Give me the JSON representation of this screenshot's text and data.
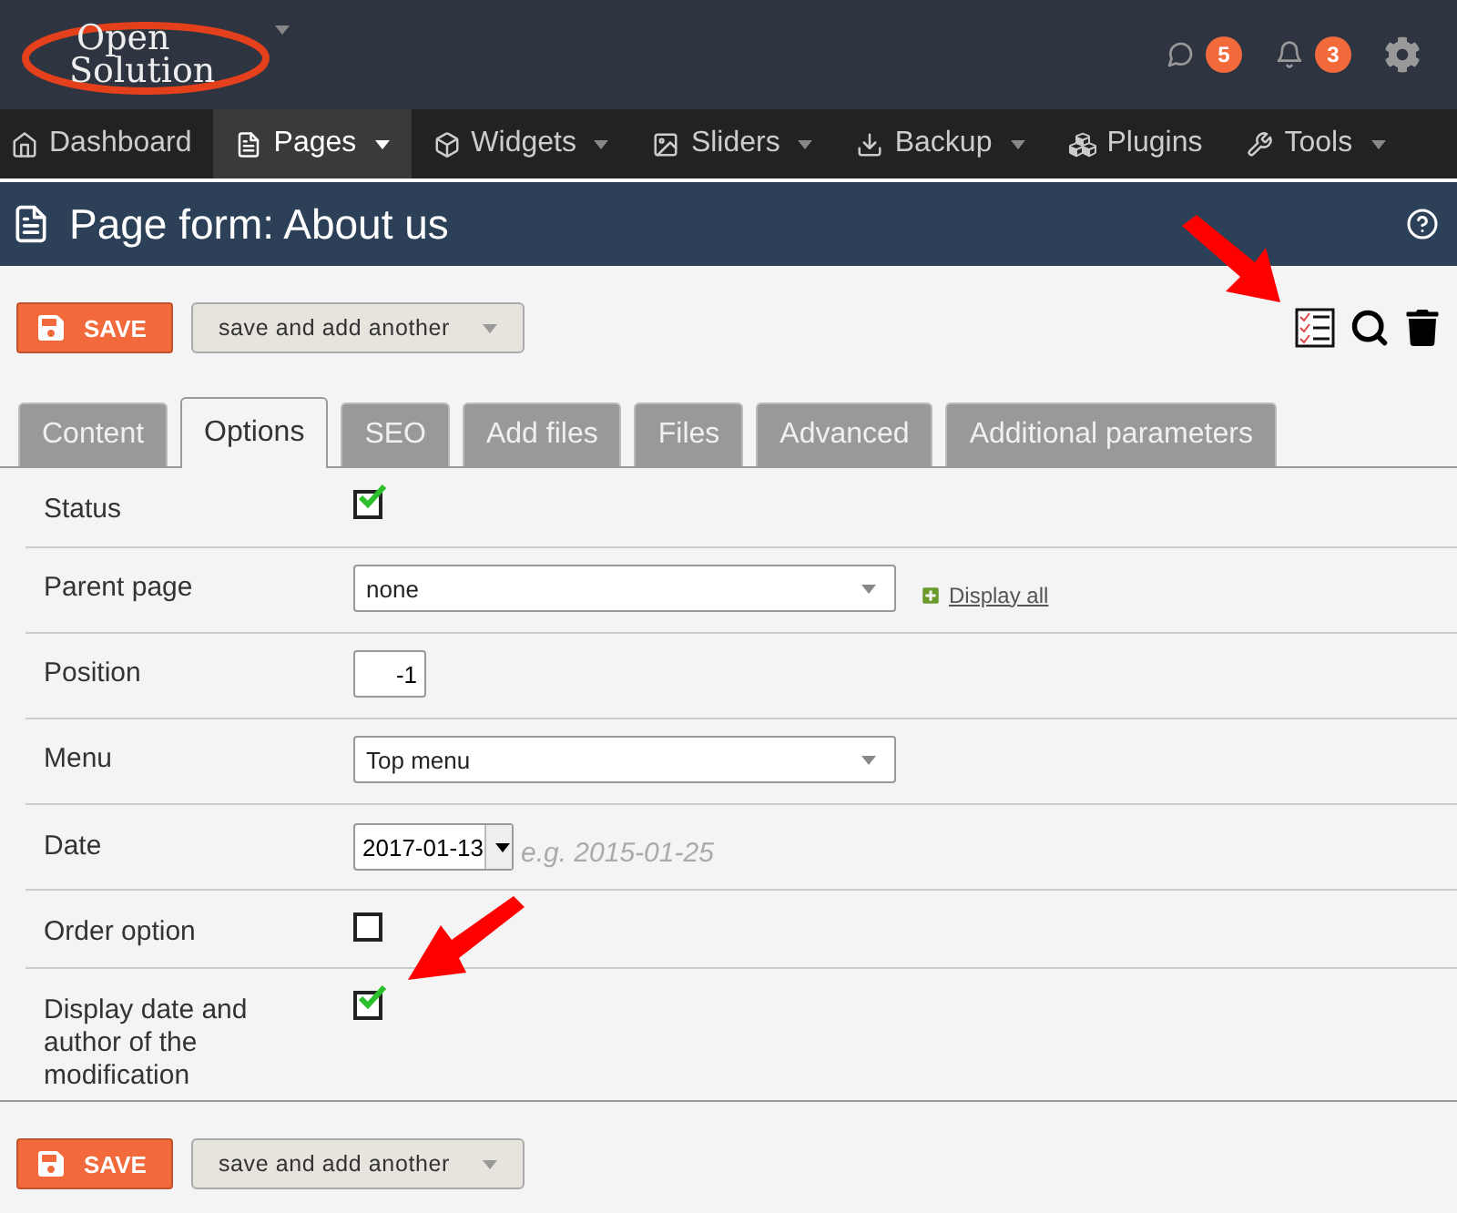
{
  "logo": {
    "line_1": "Open",
    "line_2": "Solution"
  },
  "notifications": [
    {
      "kind": "message",
      "count": "5"
    },
    {
      "kind": "bell",
      "count": "3"
    }
  ],
  "nav": [
    {
      "label": "Dashboard",
      "dropdown": false,
      "selected": false
    },
    {
      "label": "Pages",
      "dropdown": true,
      "selected": true
    },
    {
      "label": "Widgets",
      "dropdown": true,
      "selected": false
    },
    {
      "label": "Sliders",
      "dropdown": true,
      "selected": false
    },
    {
      "label": "Backup",
      "dropdown": true,
      "selected": false
    },
    {
      "label": "Plugins",
      "dropdown": false,
      "selected": false
    },
    {
      "label": "Tools",
      "dropdown": true,
      "selected": false
    }
  ],
  "page_title": "Page form: About us",
  "toolbar": {
    "save": "SAVE",
    "save_another": "save and add another"
  },
  "tabs": [
    {
      "label": "Content",
      "selected": false
    },
    {
      "label": "Options",
      "selected": true
    },
    {
      "label": "SEO",
      "selected": false
    },
    {
      "label": "Add files",
      "selected": false
    },
    {
      "label": "Files",
      "selected": false
    },
    {
      "label": "Advanced",
      "selected": false
    },
    {
      "label": "Additional parameters",
      "selected": false
    }
  ],
  "fields": [
    {
      "kind": "checkbox",
      "label": "Status",
      "checked": true
    },
    {
      "kind": "select",
      "label": "Parent page",
      "value": "none",
      "link": "Display all"
    },
    {
      "kind": "number",
      "label": "Position",
      "value": "-1"
    },
    {
      "kind": "select",
      "label": "Menu",
      "value": "Top menu"
    },
    {
      "kind": "date",
      "label": "Date",
      "value": "2017-01-13",
      "hint": "e.g. 2015-01-25"
    },
    {
      "kind": "checkbox",
      "label": "Order option",
      "checked": false
    },
    {
      "kind": "checkbox",
      "label": "Display date and author of the modification",
      "checked": true
    }
  ],
  "bottom_toolbar": {
    "save": "SAVE",
    "save_another": "save and add another"
  }
}
